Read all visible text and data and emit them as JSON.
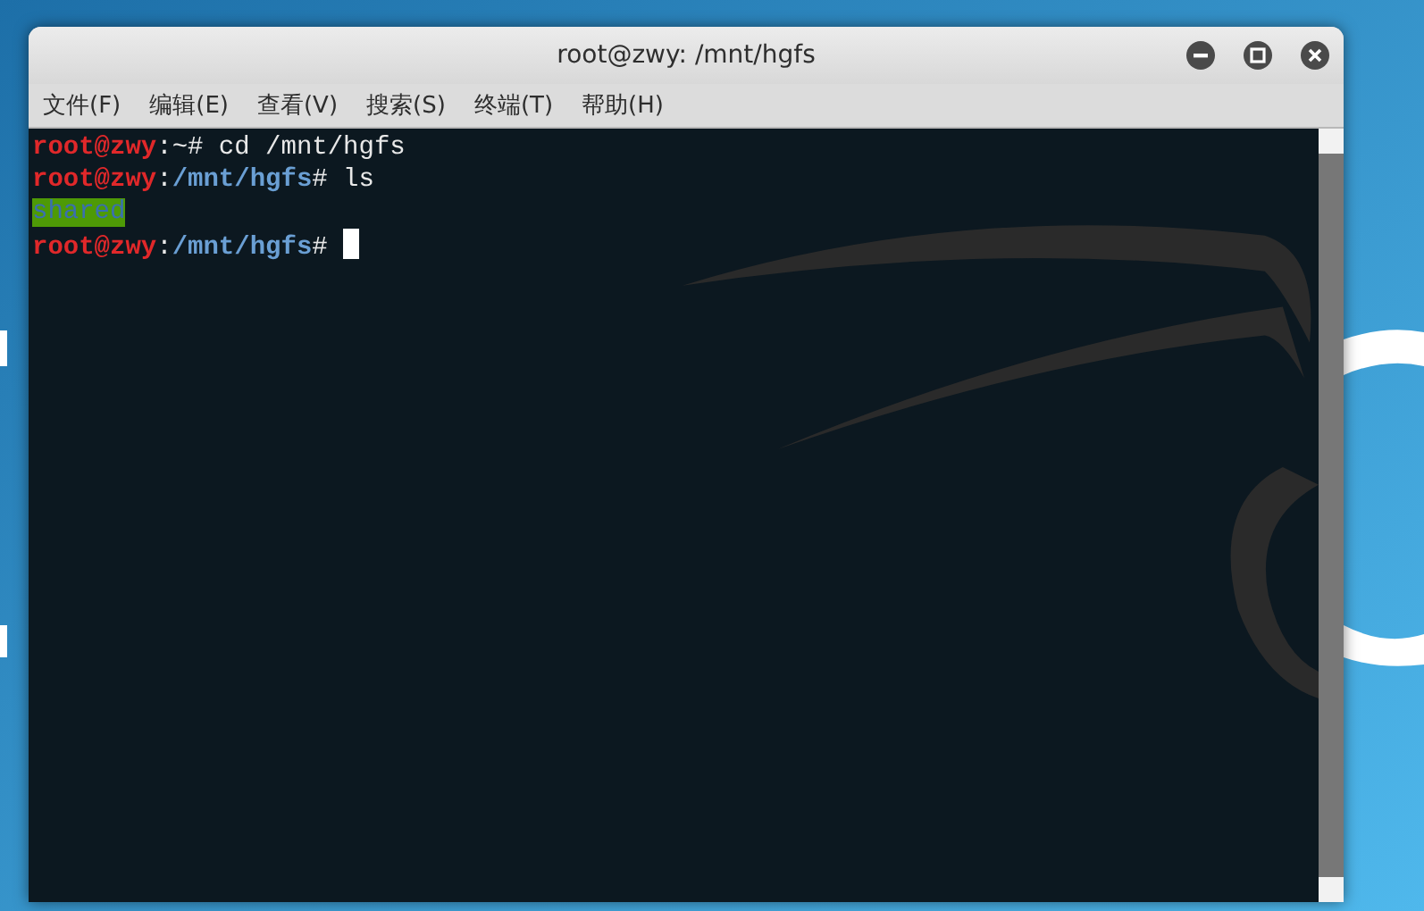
{
  "window": {
    "title": "root@zwy: /mnt/hgfs",
    "controls": [
      {
        "kind": "minimize"
      },
      {
        "kind": "maximize"
      },
      {
        "kind": "close"
      }
    ]
  },
  "menu": [
    {
      "label": "文件(F)"
    },
    {
      "label": "编辑(E)"
    },
    {
      "label": "查看(V)"
    },
    {
      "label": "搜索(S)"
    },
    {
      "label": "终端(T)"
    },
    {
      "label": "帮助(H)"
    }
  ],
  "terminal": {
    "cursor": true,
    "lines": [
      {
        "segments": [
          {
            "kind": "user",
            "text": "root@zwy"
          },
          {
            "kind": "text",
            "text": ":~# cd /mnt/hgfs"
          }
        ]
      },
      {
        "segments": [
          {
            "kind": "user",
            "text": "root@zwy"
          },
          {
            "kind": "text",
            "text": ":"
          },
          {
            "kind": "path",
            "text": "/mnt/hgfs"
          },
          {
            "kind": "text",
            "text": "# ls"
          }
        ]
      },
      {
        "segments": [
          {
            "kind": "dir",
            "text": "shared"
          }
        ]
      },
      {
        "segments": [
          {
            "kind": "user",
            "text": "root@zwy"
          },
          {
            "kind": "text",
            "text": ":"
          },
          {
            "kind": "path",
            "text": "/mnt/hgfs"
          },
          {
            "kind": "text",
            "text": "# "
          }
        ]
      }
    ]
  }
}
